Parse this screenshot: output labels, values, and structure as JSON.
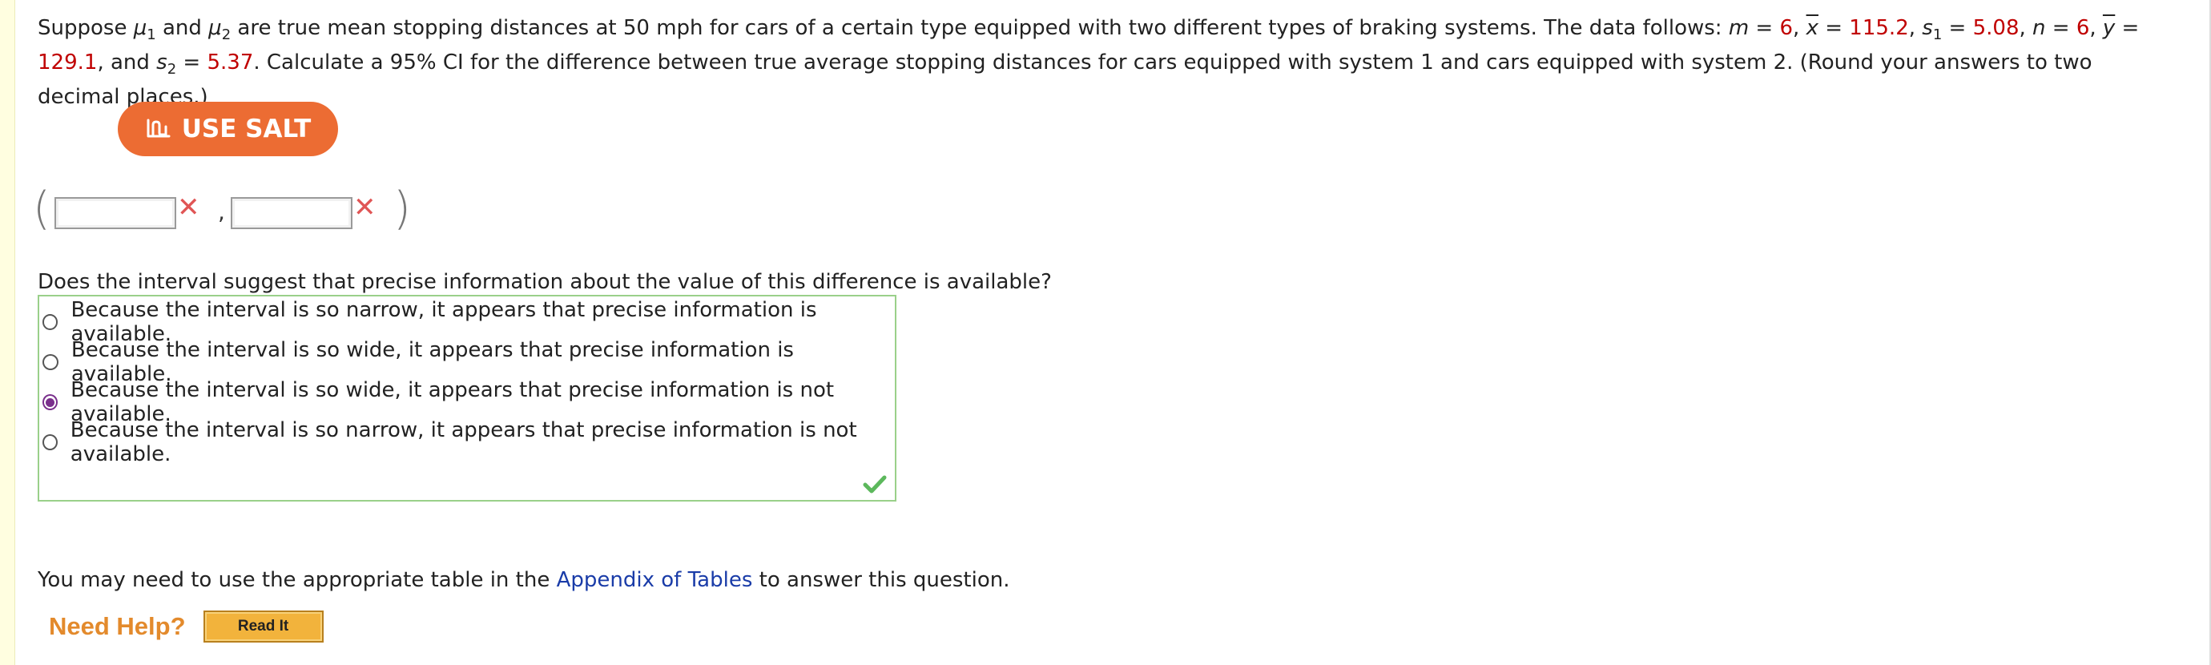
{
  "question": {
    "t1": "Suppose ",
    "mu": "μ",
    "s1": "1",
    "t2": " and ",
    "s2": "2",
    "t3": " are true mean stopping distances at 50 mph for cars of a certain type equipped with two different types of braking systems. The data follows: ",
    "m_var": "m",
    "eq": " = ",
    "m_val": "6",
    "sep": ", ",
    "xbar": "x",
    "xbar_val": "115.2",
    "s_var": "s",
    "s1_val": "5.08",
    "n_var": "n",
    "n_val": "6",
    "ybar": "y",
    "ybar_val": "129.1",
    "and": ", and ",
    "s2_val": "5.37",
    "t4": ". Calculate a 95% CI for the difference between true average stopping distances for cars equipped with system 1 and cars equipped with system 2. (Round your answers to two decimal places.)"
  },
  "salt_button": {
    "label": "USE SALT"
  },
  "interval": {
    "open_paren": "(",
    "close_paren": ")",
    "comma": ",",
    "lower_value": "",
    "upper_value": "",
    "incorrect_mark": "✕"
  },
  "prompt": "Does the interval suggest that precise information about the value of this difference is available?",
  "choices": [
    {
      "label": "Because the interval is so narrow, it appears that precise information is available.",
      "selected": false
    },
    {
      "label": "Because the interval is so wide, it appears that precise information is available.",
      "selected": false
    },
    {
      "label": "Because the interval is so wide, it appears that precise information is not available.",
      "selected": true
    },
    {
      "label": "Because the interval is so narrow, it appears that precise information is not available.",
      "selected": false
    }
  ],
  "appendix": {
    "before": "You may need to use the appropriate table in the ",
    "link": "Appendix of Tables",
    "after": " to answer this question."
  },
  "help": {
    "label": "Need Help?",
    "read_it": "Read It"
  },
  "colors": {
    "accent_orange": "#ec6c33",
    "error_red": "#e05555",
    "correct_green": "#5cb85c",
    "value_red": "#c00000",
    "link_blue": "#1a3ca8"
  }
}
